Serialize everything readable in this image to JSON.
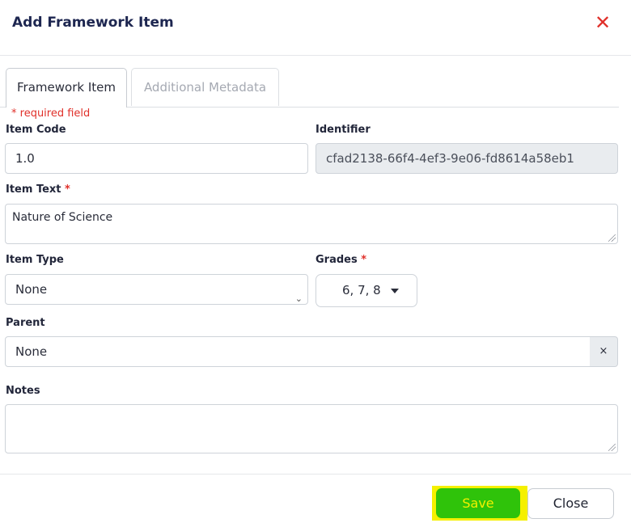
{
  "modal": {
    "title": "Add Framework Item",
    "close_icon": "close-icon"
  },
  "tabs": [
    {
      "label": "Framework Item",
      "active": true
    },
    {
      "label": "Additional Metadata",
      "active": false
    }
  ],
  "form": {
    "required_note": "* required field",
    "item_code": {
      "label": "Item Code",
      "value": "1.0"
    },
    "identifier": {
      "label": "Identifier",
      "value": "cfad2138-66f4-4ef3-9e06-fd8614a58eb1"
    },
    "item_text": {
      "label": "Item Text",
      "required_mark": "*",
      "value": "Nature of Science"
    },
    "item_type": {
      "label": "Item Type",
      "value": "None"
    },
    "grades": {
      "label": "Grades",
      "required_mark": "*",
      "value": "6, 7, 8"
    },
    "parent": {
      "label": "Parent",
      "value": "None",
      "clear_label": "×"
    },
    "notes": {
      "label": "Notes",
      "value": ""
    }
  },
  "footer": {
    "save_label": "Save",
    "close_label": "Close"
  },
  "colors": {
    "title": "#1d2650",
    "required": "#e0302a",
    "save_bg": "#2fc30a",
    "save_text": "#f3f000",
    "highlight": "#f5f000"
  }
}
